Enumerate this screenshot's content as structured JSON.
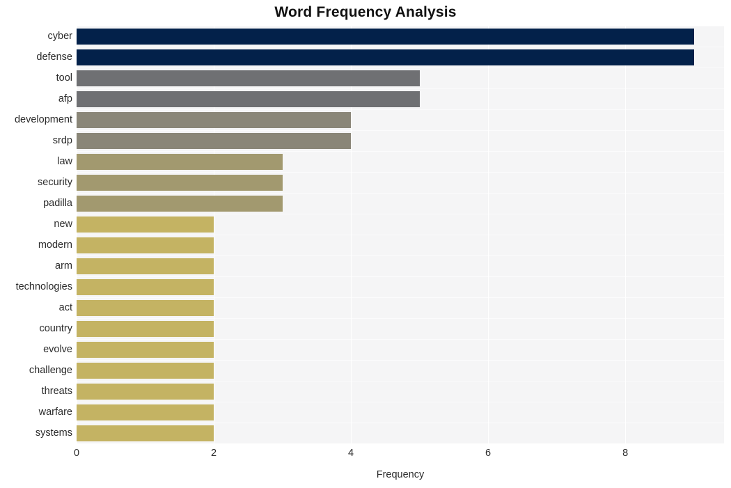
{
  "chart_data": {
    "type": "bar",
    "orientation": "horizontal",
    "title": "Word Frequency Analysis",
    "xlabel": "Frequency",
    "ylabel": "",
    "xlim": [
      0,
      9.44
    ],
    "xticks": [
      0,
      2,
      4,
      6,
      8
    ],
    "xtick_labels": [
      "0",
      "2",
      "4",
      "6",
      "8"
    ],
    "grid": true,
    "legend": null,
    "categories": [
      "cyber",
      "defense",
      "tool",
      "afp",
      "development",
      "srdp",
      "law",
      "security",
      "padilla",
      "new",
      "modern",
      "arm",
      "technologies",
      "act",
      "country",
      "evolve",
      "challenge",
      "threats",
      "warfare",
      "systems"
    ],
    "values": [
      9,
      9,
      5,
      5,
      4,
      4,
      3,
      3,
      3,
      2,
      2,
      2,
      2,
      2,
      2,
      2,
      2,
      2,
      2,
      2
    ],
    "bar_colors": [
      "#03214a",
      "#03214a",
      "#6f7073",
      "#6f7073",
      "#8a8678",
      "#8a8678",
      "#a2996f",
      "#a2996f",
      "#a2996f",
      "#c4b363",
      "#c4b363",
      "#c4b363",
      "#c4b363",
      "#c4b363",
      "#c4b363",
      "#c4b363",
      "#c4b363",
      "#c4b363",
      "#c4b363",
      "#c4b363"
    ]
  },
  "style": {
    "figure_background": "#ffffff",
    "plot_background": "#f5f5f6",
    "grid_color": "#ffffff",
    "text_color": "#2b2b2b",
    "title_color": "#111111"
  }
}
